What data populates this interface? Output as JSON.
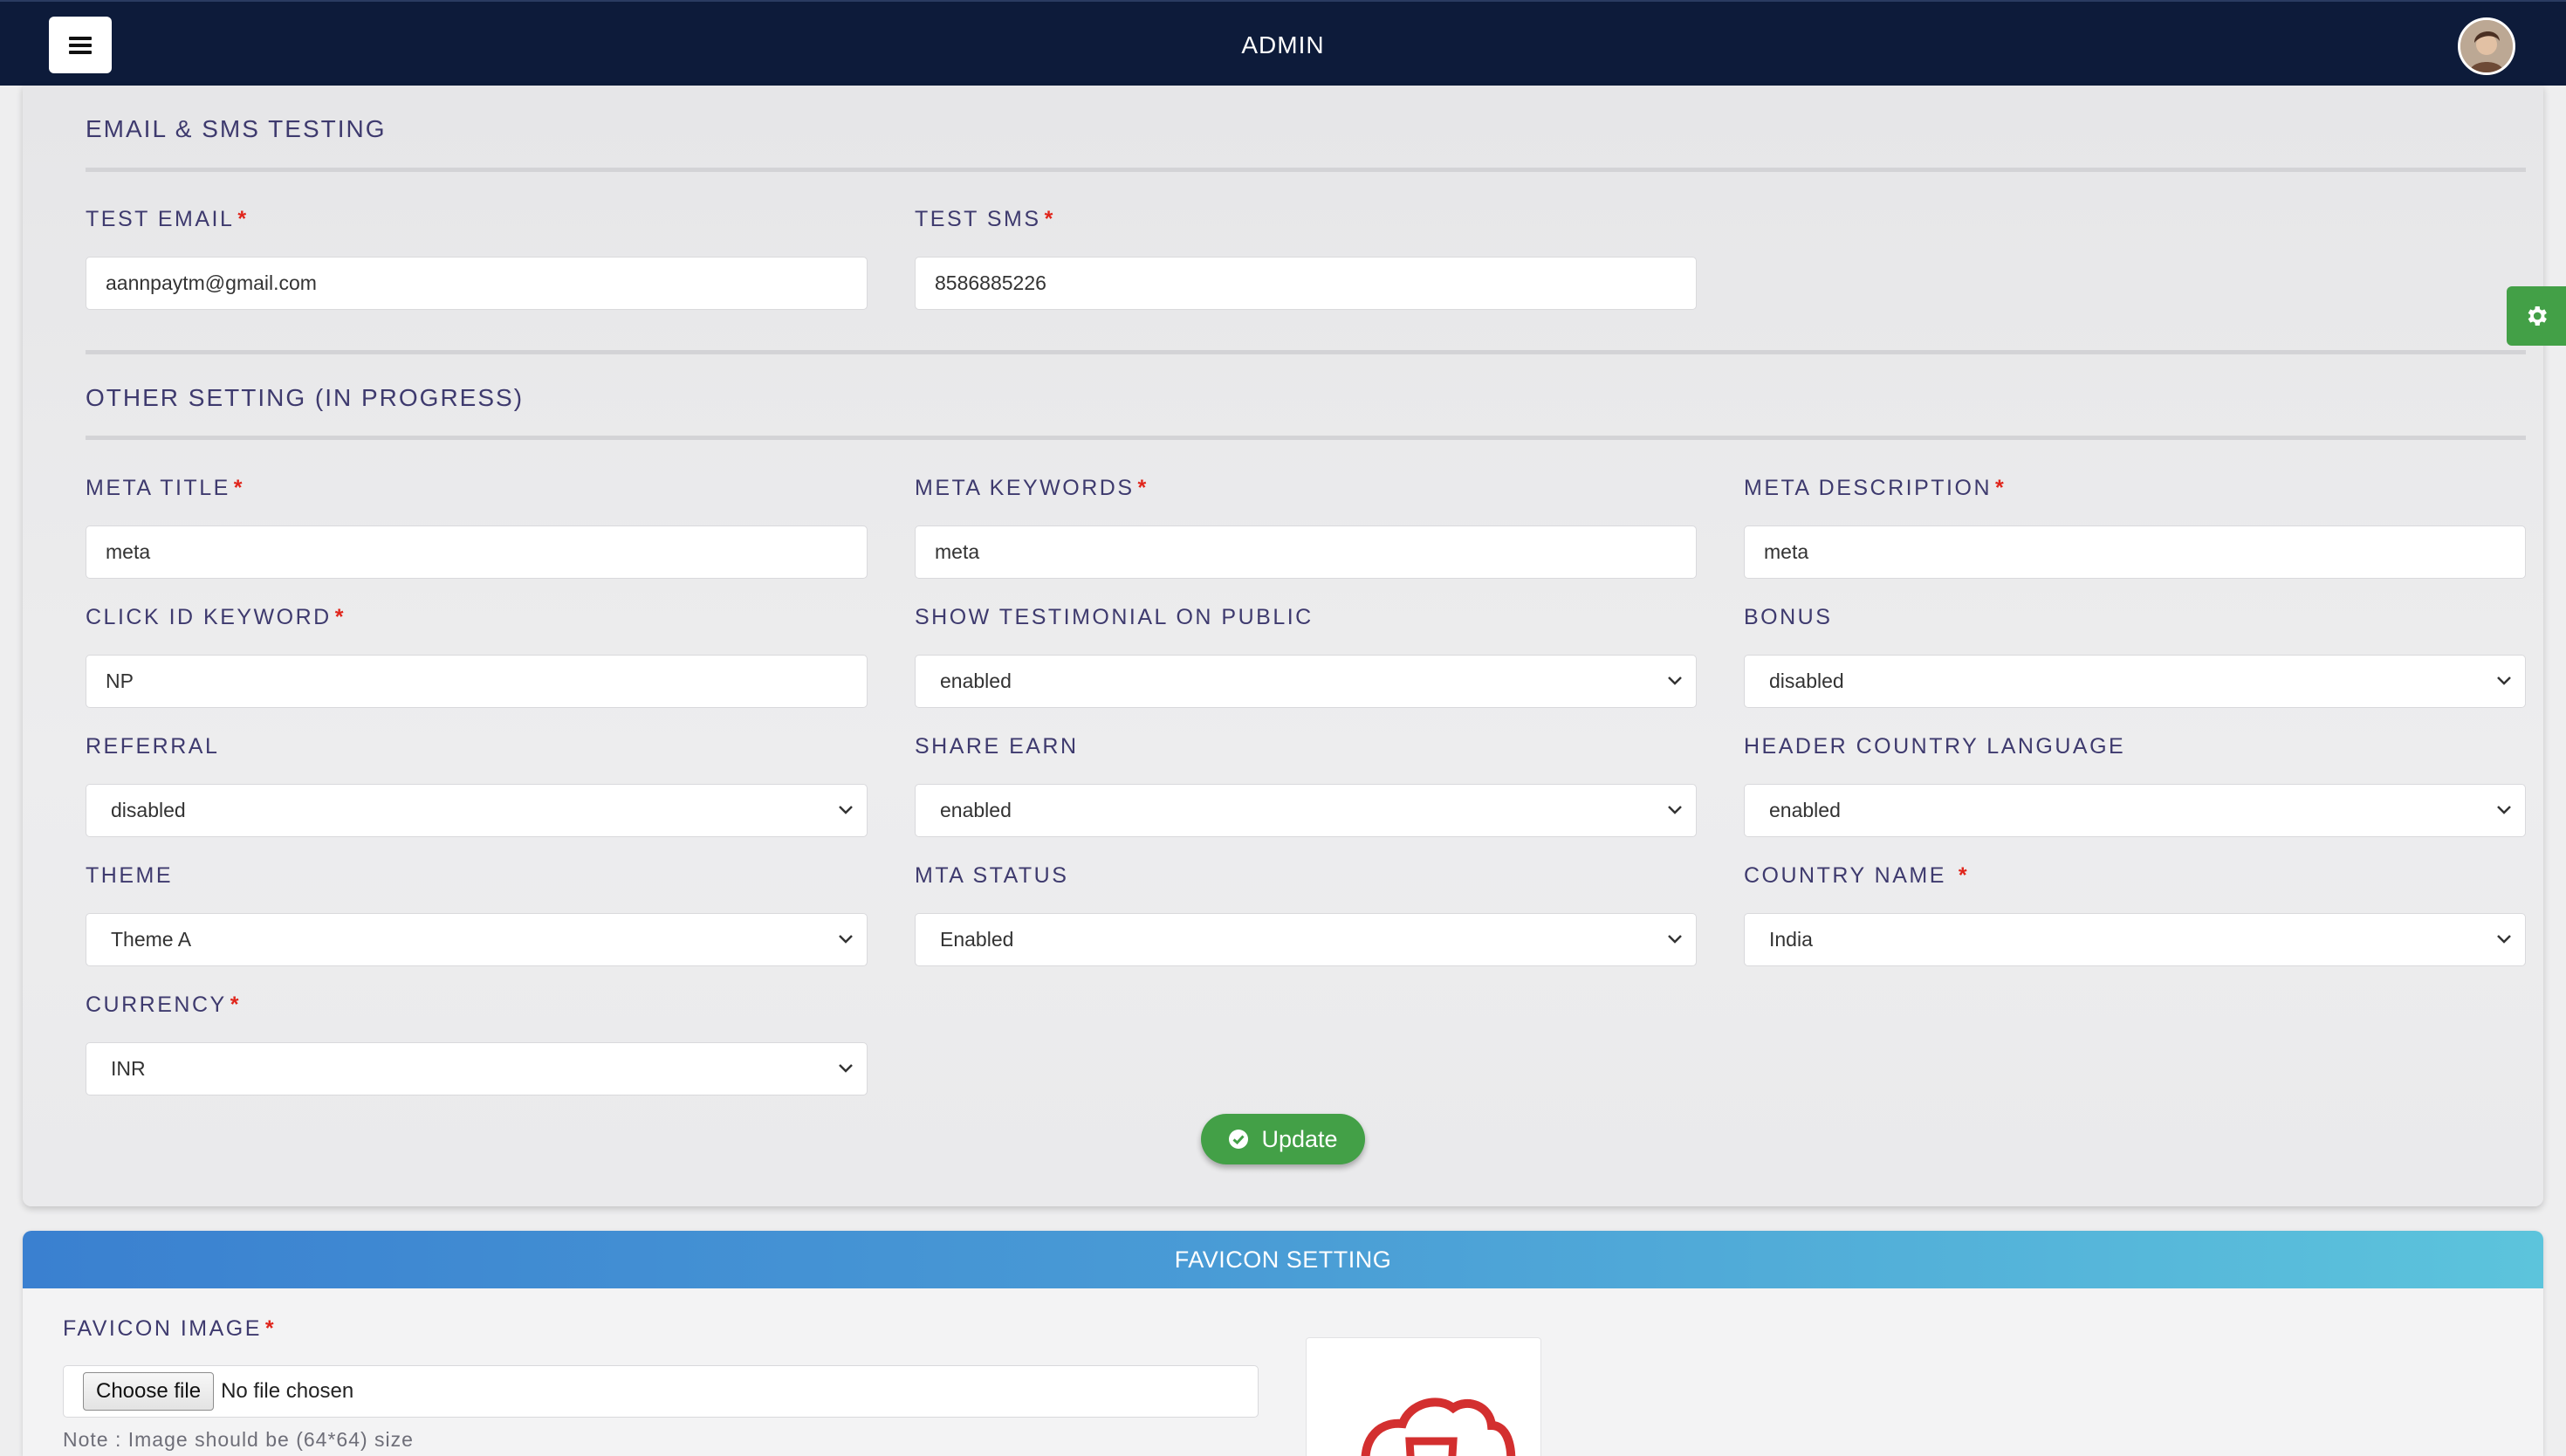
{
  "header": {
    "title": "ADMIN",
    "menu_icon": "hamburger-icon",
    "avatar_icon": "user-avatar"
  },
  "email_sms": {
    "title": "EMAIL & SMS TESTING",
    "test_email": {
      "label": "TEST EMAIL",
      "value": "aannpaytm@gmail.com"
    },
    "test_sms": {
      "label": "TEST SMS",
      "value": "8586885226"
    }
  },
  "other": {
    "title": "OTHER SETTING (IN PROGRESS)",
    "meta_title": {
      "label": "META TITLE",
      "value": "meta"
    },
    "meta_keywords": {
      "label": "META KEYWORDS",
      "value": "meta"
    },
    "meta_description": {
      "label": "META DESCRIPTION",
      "value": "meta"
    },
    "click_id": {
      "label": "CLICK ID KEYWORD",
      "value": "NP"
    },
    "testimonial": {
      "label": "SHOW TESTIMONIAL ON PUBLIC",
      "value": "enabled"
    },
    "bonus": {
      "label": "BONUS",
      "value": "disabled"
    },
    "referral": {
      "label": "REFERRAL",
      "value": "disabled"
    },
    "share_earn": {
      "label": "SHARE EARN",
      "value": "enabled"
    },
    "header_lang": {
      "label": "HEADER COUNTRY LANGUAGE",
      "value": "enabled"
    },
    "theme": {
      "label": "THEME",
      "value": "Theme A"
    },
    "mta_status": {
      "label": "MTA STATUS",
      "value": "Enabled"
    },
    "country": {
      "label": "COUNTRY NAME",
      "value": "India"
    },
    "currency": {
      "label": "CURRENCY",
      "value": "INR"
    },
    "required_mark": "*"
  },
  "update_button": {
    "label": "Update",
    "icon": "check-circle-icon"
  },
  "settings_icon": "gear-icon",
  "favicon": {
    "title": "FAVICON SETTING",
    "label": "FAVICON IMAGE",
    "choose_label": "Choose file",
    "file_status": "No file chosen",
    "note": "Note : Image should be (64*64) size"
  },
  "colors": {
    "navbar": "#0d1b3a",
    "accent_green": "#43a047",
    "required_red": "#e0251b",
    "label_text": "#3e3a6e"
  }
}
